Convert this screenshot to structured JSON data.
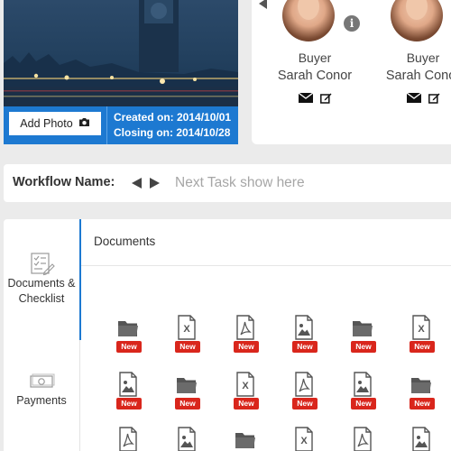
{
  "property": {
    "add_photo_label": "Add Photo",
    "created_on": "Created on: 2014/10/01",
    "closing_on": "Closing on: 2014/10/28"
  },
  "buyers": [
    {
      "role": "Buyer",
      "name": "Sarah Conor",
      "info_glyph": "i"
    },
    {
      "role": "Buyer",
      "name": "Sarah Conor"
    }
  ],
  "workflow": {
    "label": "Workflow Name:",
    "next_task_placeholder": "Next Task show here"
  },
  "sidebar": {
    "items": [
      {
        "label": "Documents & Checklist",
        "icon": "checklist-icon"
      },
      {
        "label": "Payments",
        "icon": "money-icon"
      }
    ]
  },
  "documents": {
    "title": "Documents",
    "badge_label": "New",
    "rows": [
      [
        "folder",
        "excel",
        "pdf",
        "image",
        "folder",
        "excel"
      ],
      [
        "image",
        "folder",
        "excel",
        "pdf",
        "image",
        "folder"
      ],
      [
        "pdf",
        "image",
        "folder",
        "excel",
        "pdf",
        "image"
      ]
    ]
  },
  "colors": {
    "accent": "#1d79d1",
    "badge": "#d9261c",
    "icon": "#555555"
  }
}
